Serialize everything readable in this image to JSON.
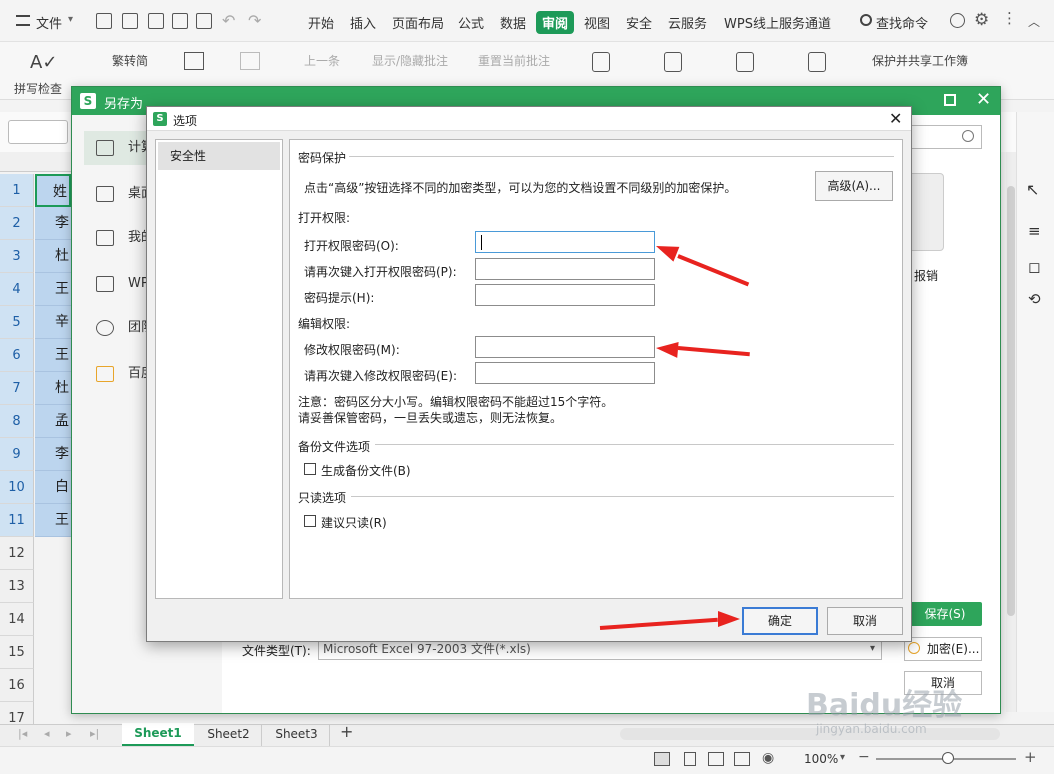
{
  "menubar": {
    "file": "文件",
    "tabs": [
      "开始",
      "插入",
      "页面布局",
      "公式",
      "数据",
      "审阅",
      "视图",
      "安全",
      "云服务",
      "WPS线上服务通道"
    ],
    "active_tab": "审阅",
    "search": "查找命令"
  },
  "ribbon": {
    "spell_check": "拼写检查",
    "trad_simp": "繁转简",
    "prev_comment": "上一条",
    "show_hide_comment": "显示/隐藏批注",
    "reset_comment": "重置当前批注",
    "protect_share": "保护并共享工作簿"
  },
  "sheet": {
    "row_numbers": [
      "1",
      "2",
      "3",
      "4",
      "5",
      "6",
      "7",
      "8",
      "9",
      "10",
      "11",
      "12",
      "13",
      "14",
      "15",
      "16",
      "17"
    ],
    "cells": [
      "姓",
      "李",
      "杜",
      "王",
      "辛",
      "王",
      "杜",
      "孟",
      "李",
      "白",
      "王"
    ],
    "tabs": [
      "Sheet1",
      "Sheet2",
      "Sheet3"
    ],
    "zoom": "100%"
  },
  "saveas": {
    "title": "另存为",
    "nav": [
      "计算机",
      "桌面",
      "我的文档",
      "WPS云文档",
      "团队文档",
      "百度网盘"
    ],
    "file_name_partial": "报销",
    "file_type_label": "文件类型(T):",
    "file_type_value": "Microsoft Excel 97-2003 文件(*.xls)",
    "save_button": "保存(S)",
    "encrypt_button": "加密(E)...",
    "cancel_button": "取消"
  },
  "options": {
    "title": "选项",
    "sidebar_item": "安全性",
    "password_section": "密码保护",
    "password_desc": "点击“高级”按钮选择不同的加密类型，可以为您的文档设置不同级别的加密保护。",
    "advanced_button": "高级(A)...",
    "open_section": "打开权限:",
    "open_pwd_label": "打开权限密码(O):",
    "open_pwd_confirm_label": "请再次键入打开权限密码(P):",
    "hint_label": "密码提示(H):",
    "edit_section": "编辑权限:",
    "edit_pwd_label": "修改权限密码(M):",
    "edit_pwd_confirm_label": "请再次键入修改权限密码(E):",
    "note1": "注意：密码区分大小写。编辑权限密码不能超过15个字符。",
    "note2": "请妥善保管密码，一旦丢失或遗忘，则无法恢复。",
    "backup_section": "备份文件选项",
    "backup_check": "生成备份文件(B)",
    "readonly_section": "只读选项",
    "readonly_check": "建议只读(R)",
    "ok_button": "确定",
    "cancel_button": "取消"
  },
  "watermark": {
    "brand": "Baidu经验",
    "url": "jingyan.baidu.com"
  },
  "colors": {
    "accent": "#2ea55b",
    "arrow": "#e8231f",
    "selection": "#bcd5ee"
  }
}
